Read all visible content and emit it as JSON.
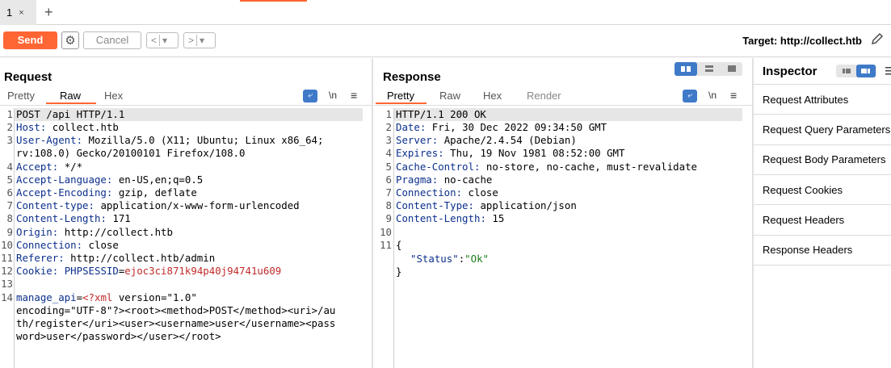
{
  "tabs": {
    "tab1_label": "1",
    "close": "×",
    "add": "+"
  },
  "toolbar": {
    "send": "Send",
    "gear": "⚙",
    "cancel": "Cancel",
    "back": "<",
    "fwd": ">",
    "drop": "▾",
    "target": "Target: http://collect.htb"
  },
  "request": {
    "title": "Request",
    "tabs": [
      "Pretty",
      "Raw",
      "Hex"
    ],
    "wrap_icon": "⤶",
    "newline_label": "\\n",
    "menu_icon": "≡",
    "line_numbers": [
      "1",
      "2",
      "3",
      "4",
      "5",
      "6",
      "7",
      "8",
      "9",
      "10",
      "11",
      "12",
      "13",
      "14"
    ],
    "lines": [
      {
        "k": "",
        "v": "POST /api HTTP/1.1"
      },
      {
        "k": "Host",
        "v": " collect.htb"
      },
      {
        "k": "User-Agent",
        "v": " Mozilla/5.0 (X11; Ubuntu; Linux x86_64;"
      },
      {
        "k": "",
        "v": "rv:108.0) Gecko/20100101 Firefox/108.0"
      },
      {
        "k": "Accept",
        "v": " */*"
      },
      {
        "k": "Accept-Language",
        "v": " en-US,en;q=0.5"
      },
      {
        "k": "Accept-Encoding",
        "v": " gzip, deflate"
      },
      {
        "k": "Content-type",
        "v": " application/x-www-form-urlencoded"
      },
      {
        "k": "Content-Length",
        "v": " 171"
      },
      {
        "k": "Origin",
        "v": " http://collect.htb"
      },
      {
        "k": "Connection",
        "v": " close"
      },
      {
        "k": "Referer",
        "v": " http://collect.htb/admin"
      }
    ],
    "cookie": {
      "k": "Cookie",
      "name": "PHPSESSID",
      "eq": "=",
      "val": "ejoc3ci871k94p40j94741u609"
    },
    "body": {
      "param": "manage_api",
      "eq": "=",
      "xml_start": "<?xml",
      "rest1": " version=\"1.0\"",
      "line2": "encoding=\"UTF-8\"?><root><method>POST</method><uri>/au",
      "line3": "th/register</uri><user><username>user</username><pass",
      "line4": "word>user</password></user></root>"
    }
  },
  "response": {
    "title": "Response",
    "tabs": [
      "Pretty",
      "Raw",
      "Hex",
      "Render"
    ],
    "wrap_icon": "⤶",
    "newline_label": "\\n",
    "menu_icon": "≡",
    "line_numbers": [
      "1",
      "2",
      "3",
      "4",
      "5",
      "6",
      "7",
      "8",
      "9",
      "10",
      "11"
    ],
    "lines": [
      {
        "k": "",
        "v": "HTTP/1.1 200 OK"
      },
      {
        "k": "Date",
        "v": " Fri, 30 Dec 2022 09:34:50 GMT"
      },
      {
        "k": "Server",
        "v": " Apache/2.4.54 (Debian)"
      },
      {
        "k": "Expires",
        "v": " Thu, 19 Nov 1981 08:52:00 GMT"
      },
      {
        "k": "Cache-Control",
        "v": " no-store, no-cache, must-revalidate"
      },
      {
        "k": "Pragma",
        "v": " no-cache"
      },
      {
        "k": "Connection",
        "v": " close"
      },
      {
        "k": "Content-Type",
        "v": " application/json"
      },
      {
        "k": "Content-Length",
        "v": " 15"
      }
    ],
    "json_open": "{",
    "json_key": "\"Status\"",
    "json_colon": ":",
    "json_val": "\"Ok\"",
    "json_close": "}"
  },
  "inspector": {
    "title": "Inspector",
    "items": [
      "Request Attributes",
      "Request Query Parameters",
      "Request Body Parameters",
      "Request Cookies",
      "Request Headers",
      "Response Headers"
    ]
  },
  "colors": {
    "accent": "#ff6633",
    "header_key": "#0b2f8c",
    "cookie_value": "#c12a2a",
    "json_string": "#1a7a1a",
    "layout_icon": "#3f7ac8"
  }
}
